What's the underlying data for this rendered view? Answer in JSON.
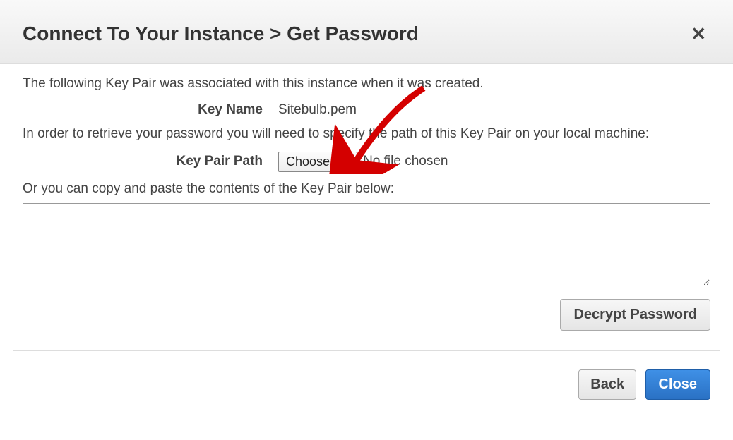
{
  "header": {
    "title": "Connect To Your Instance > Get Password"
  },
  "intro": "The following Key Pair was associated with this instance when it was created.",
  "key_name_label": "Key Name",
  "key_name_value": "Sitebulb.pem",
  "instructions": "In order to retrieve your password you will need to specify the path of this Key Pair on your local machine:",
  "key_pair_path_label": "Key Pair Path",
  "choose_file_label": "Choose file",
  "no_file_text": "No file chosen",
  "copy_paste_text": "Or you can copy and paste the contents of the Key Pair below:",
  "textarea_value": "",
  "decrypt_label": "Decrypt Password",
  "back_label": "Back",
  "close_label": "Close"
}
